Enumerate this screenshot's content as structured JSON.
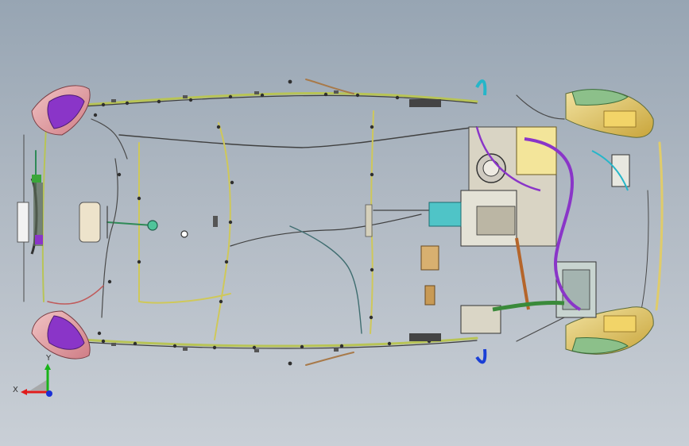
{
  "view": {
    "background_top": "#97a5b3",
    "background_bottom": "#c9cfd6"
  },
  "triad": {
    "x_label": "X",
    "y_label": "Y",
    "x_color": "#e01b1b",
    "y_color": "#18b318",
    "z_color": "#1a2fd6"
  },
  "model": {
    "parts": [
      "front-left-lamp",
      "front-right-lamp",
      "rear-left-lamp",
      "rear-right-lamp",
      "engine-bay",
      "body-harness",
      "roof-harness",
      "instrument-panel"
    ],
    "colors": {
      "harness_main": "#d8d060",
      "harness_green": "#3a7f3a",
      "harness_dark": "#4c4c4c",
      "purple": "#8a35c8",
      "lamp_pink": "#e8a9a9",
      "lamp_yellow": "#e6c85a",
      "cyan": "#25b6c9",
      "brown": "#9d6a3a"
    }
  }
}
